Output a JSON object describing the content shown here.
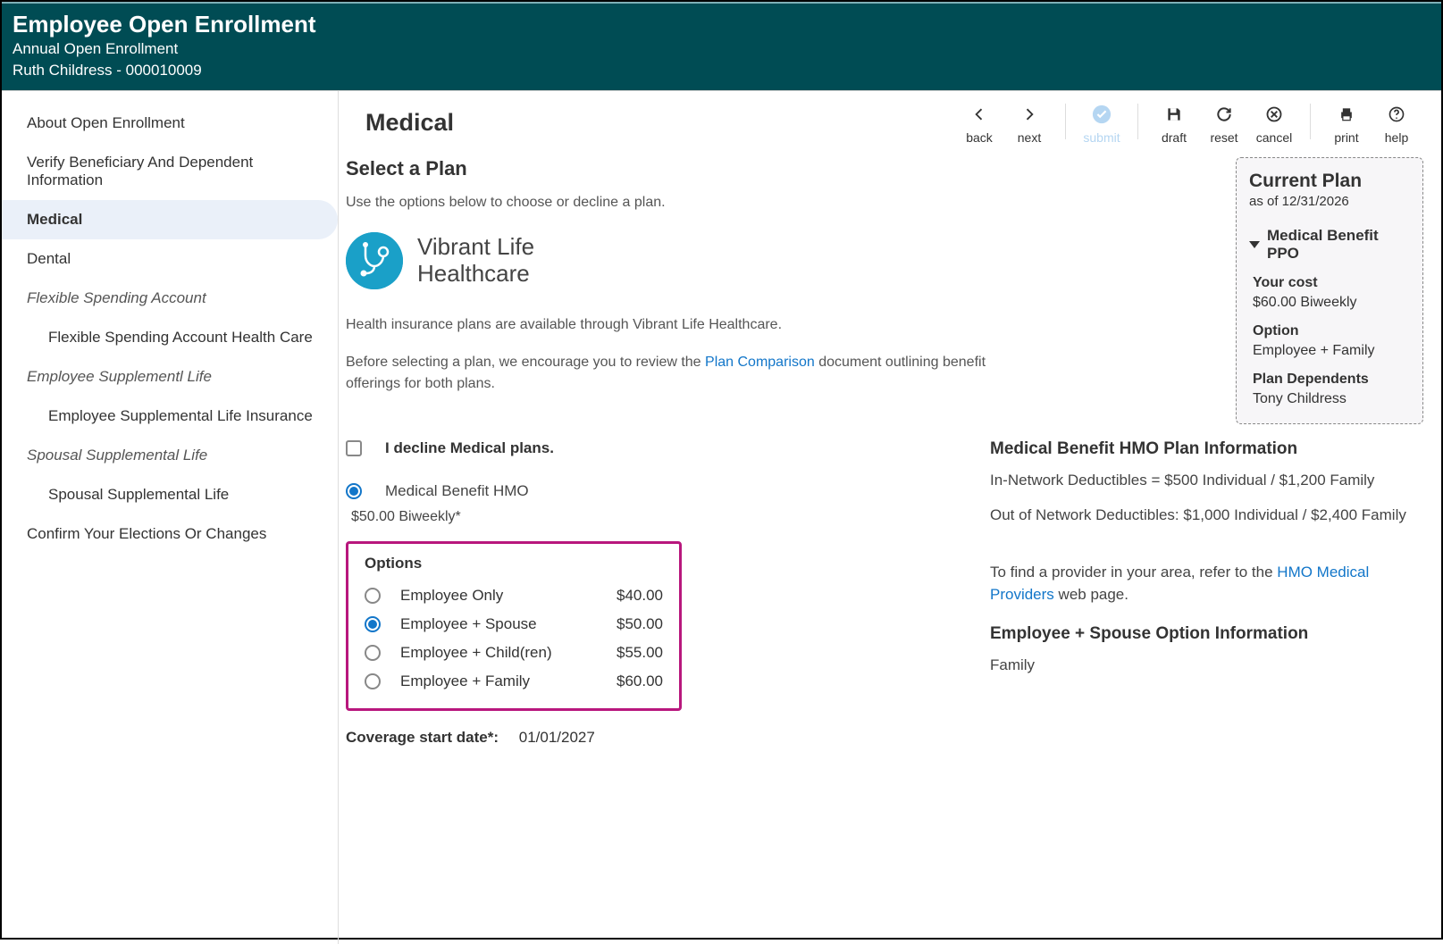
{
  "header": {
    "title": "Employee Open Enrollment",
    "subtitle": "Annual Open Enrollment",
    "user_name": "Ruth Childress",
    "user_id": "000010009"
  },
  "sidebar": {
    "items": [
      {
        "label": "About Open Enrollment",
        "type": "link"
      },
      {
        "label": "Verify Beneficiary And Dependent Information",
        "type": "link"
      },
      {
        "label": "Medical",
        "type": "link",
        "active": true
      },
      {
        "label": "Dental",
        "type": "link"
      },
      {
        "label": "Flexible Spending Account",
        "type": "group"
      },
      {
        "label": "Flexible Spending Account Health Care",
        "type": "child"
      },
      {
        "label": "Employee Supplementl Life",
        "type": "group"
      },
      {
        "label": "Employee Supplemental Life Insurance",
        "type": "child"
      },
      {
        "label": "Spousal Supplemental Life",
        "type": "group"
      },
      {
        "label": "Spousal Supplemental Life",
        "type": "child"
      },
      {
        "label": "Confirm Your Elections Or Changes",
        "type": "link"
      }
    ]
  },
  "toolbar": {
    "page_title": "Medical",
    "back": "back",
    "next": "next",
    "submit": "submit",
    "draft": "draft",
    "reset": "reset",
    "cancel": "cancel",
    "print": "print",
    "help": "help"
  },
  "content": {
    "select_heading": "Select a Plan",
    "instruction": "Use the options below to choose or decline a plan.",
    "provider": {
      "line1": "Vibrant Life",
      "line2": "Healthcare"
    },
    "desc1": "Health insurance plans are available through Vibrant Life Healthcare.",
    "desc2a": "Before selecting a plan, we encourage you to review the ",
    "desc2_link": "Plan Comparison",
    "desc2b": " document outlining benefit offerings for both plans.",
    "decline_label": "I decline Medical plans.",
    "plan": {
      "name": "Medical Benefit HMO",
      "cost": "$50.00 Biweekly*"
    },
    "options_title": "Options",
    "options": [
      {
        "label": "Employee Only",
        "price": "$40.00",
        "selected": false
      },
      {
        "label": "Employee + Spouse",
        "price": "$50.00",
        "selected": true
      },
      {
        "label": "Employee + Child(ren)",
        "price": "$55.00",
        "selected": false
      },
      {
        "label": "Employee + Family",
        "price": "$60.00",
        "selected": false
      }
    ],
    "coverage_label": "Coverage start date*:",
    "coverage_value": "01/01/2027"
  },
  "info": {
    "hmo_title": "Medical Benefit HMO Plan Information",
    "hmo_in": "In-Network Deductibles = $500 Individual / $1,200 Family",
    "hmo_out": "Out of Network Deductibles: $1,000 Individual / $2,400 Family",
    "provider_pre": "To find a provider in your area, refer to the ",
    "provider_link": "HMO Medical Providers",
    "provider_post": " web page.",
    "opt_title": "Employee + Spouse Option Information",
    "opt_line": "Family"
  },
  "card": {
    "title": "Current Plan",
    "asof": "as of 12/31/2026",
    "plan_name": "Medical Benefit PPO",
    "cost_label": "Your cost",
    "cost_value": "$60.00 Biweekly",
    "option_label": "Option",
    "option_value": "Employee + Family",
    "dep_label": "Plan Dependents",
    "dep_value": "Tony Childress"
  }
}
